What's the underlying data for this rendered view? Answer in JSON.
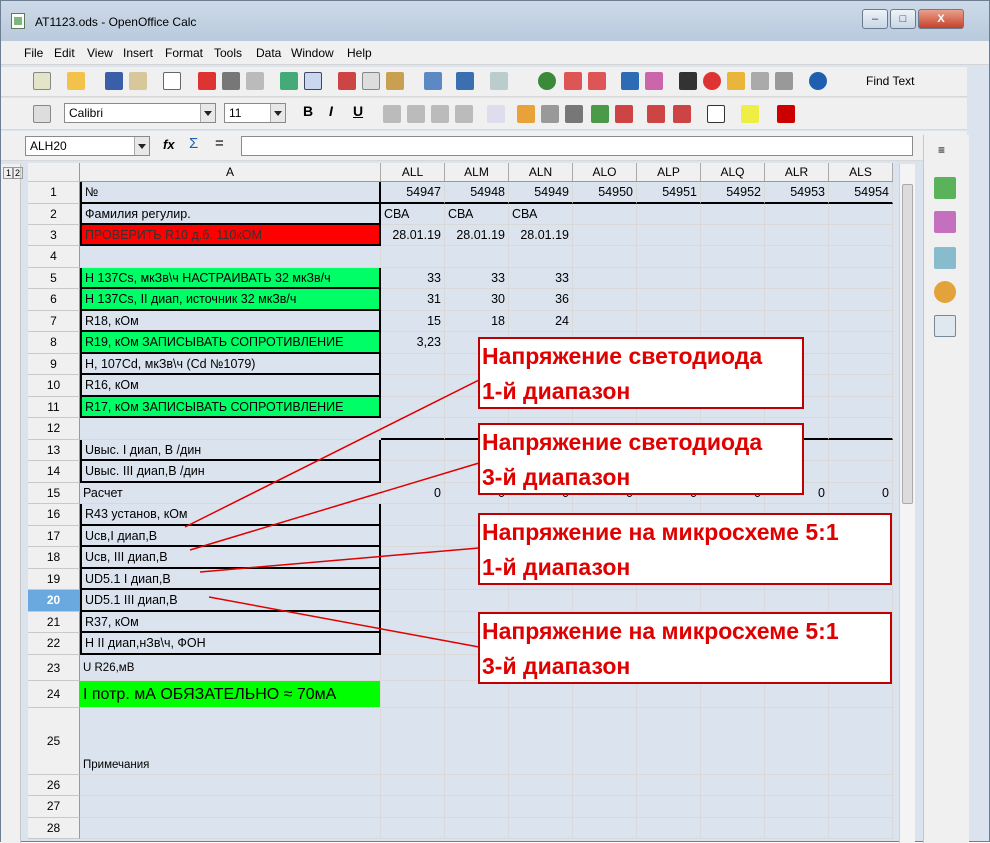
{
  "window": {
    "title": "AT1123.ods - OpenOffice Calc",
    "min": "–",
    "max": "□",
    "close": "X"
  },
  "menu": [
    "File",
    "Edit",
    "View",
    "Insert",
    "Format",
    "Tools",
    "Data",
    "Window",
    "Help"
  ],
  "toolbar": {
    "find_text": "Find Text"
  },
  "format": {
    "font": "Calibri",
    "size": "11",
    "bold": "B",
    "italic": "I",
    "underline": "U"
  },
  "formula": {
    "name_box": "ALH20",
    "fx": "fx",
    "sum": "Σ",
    "eq": "="
  },
  "outline_levels": [
    "1",
    "2"
  ],
  "columns": [
    "A",
    "ALL",
    "ALM",
    "ALN",
    "ALO",
    "ALP",
    "ALQ",
    "ALR",
    "ALS"
  ],
  "rows": [
    {
      "n": "1",
      "a": "№",
      "v": [
        "54947",
        "54948",
        "54949",
        "54950",
        "54951",
        "54952",
        "54953",
        "54954"
      ]
    },
    {
      "n": "2",
      "a": "Фамилия регулир.",
      "v": [
        "СВА",
        "СВА",
        "СВА",
        "",
        "",
        "",
        "",
        ""
      ]
    },
    {
      "n": "3",
      "a": "ПРОВЕРИТЬ R10 д.б. 110кОМ",
      "v": [
        "28.01.19",
        "28.01.19",
        "28.01.19",
        "",
        "",
        "",
        "",
        ""
      ]
    },
    {
      "n": "4",
      "a": "",
      "v": [
        "",
        "",
        "",
        "",
        "",
        "",
        "",
        ""
      ]
    },
    {
      "n": "5",
      "a": "Н 137Cs, мкЗв\\ч   НАСТРАИВАТЬ 32 мкЗв/ч",
      "v": [
        "33",
        "33",
        "33",
        "",
        "",
        "",
        "",
        ""
      ]
    },
    {
      "n": "6",
      "a": "Н 137Cs, II диап, источник 32 мкЗв/ч",
      "v": [
        "31",
        "30",
        "36",
        "",
        "",
        "",
        "",
        ""
      ]
    },
    {
      "n": "7",
      "a": "R18, кОм",
      "v": [
        "15",
        "18",
        "24",
        "",
        "",
        "",
        "",
        ""
      ]
    },
    {
      "n": "8",
      "a": "R19, кОм  ЗАПИСЫВАТЬ СОПРОТИВЛЕНИЕ",
      "v": [
        "3,23",
        "",
        "",
        "",
        "",
        "",
        "",
        ""
      ]
    },
    {
      "n": "9",
      "a": "Н, 107Cd, мкЗв\\ч   (Cd  №1079)",
      "v": [
        "",
        "",
        "",
        "",
        "",
        "",
        "",
        ""
      ]
    },
    {
      "n": "10",
      "a": "R16, кОм",
      "v": [
        "",
        "",
        "",
        "",
        "",
        "",
        "",
        ""
      ]
    },
    {
      "n": "11",
      "a": "R17, кОм ЗАПИСЫВАТЬ СОПРОТИВЛЕНИЕ",
      "v": [
        "",
        "",
        "",
        "",
        "",
        "",
        "",
        ""
      ]
    },
    {
      "n": "12",
      "a": "",
      "v": [
        "",
        "",
        "",
        "",
        "",
        "",
        "",
        ""
      ]
    },
    {
      "n": "13",
      "a": "Uвыс. I диап, В /дин",
      "v": [
        "",
        "",
        "",
        "",
        "",
        "",
        "",
        ""
      ]
    },
    {
      "n": "14",
      "a": "Uвыс. III диап,В /дин",
      "v": [
        "",
        "",
        "",
        "",
        "",
        "",
        "",
        ""
      ]
    },
    {
      "n": "15",
      "a": "Расчет",
      "v": [
        "0",
        "0",
        "0",
        "0",
        "0",
        "0",
        "0",
        "0"
      ]
    },
    {
      "n": "16",
      "a": "R43 установ, кОм",
      "v": [
        "",
        "",
        "",
        "",
        "",
        "",
        "",
        ""
      ]
    },
    {
      "n": "17",
      "a": "Uсв,I диап,В",
      "v": [
        "",
        "",
        "",
        "",
        "",
        "",
        "",
        ""
      ]
    },
    {
      "n": "18",
      "a": "Uсв, III диап,В",
      "v": [
        "",
        "",
        "",
        "",
        "",
        "",
        "",
        ""
      ]
    },
    {
      "n": "19",
      "a": "UD5.1 I диап,В",
      "v": [
        "",
        "",
        "",
        "",
        "",
        "",
        "",
        ""
      ]
    },
    {
      "n": "20",
      "a": "UD5.1 III диап,В",
      "v": [
        "",
        "",
        "",
        "",
        "",
        "",
        "",
        ""
      ]
    },
    {
      "n": "21",
      "a": "R37, кОм",
      "v": [
        "",
        "",
        "",
        "",
        "",
        "",
        "",
        ""
      ]
    },
    {
      "n": "22",
      "a": "Н II диап,нЗв\\ч, ФОН",
      "v": [
        "",
        "",
        "",
        "",
        "",
        "",
        "",
        ""
      ]
    },
    {
      "n": "23",
      "a": "U R26,мВ",
      "v": [
        "",
        "",
        "",
        "",
        "",
        "",
        "",
        ""
      ]
    },
    {
      "n": "24",
      "a": "I потр. мА ОБЯЗАТЕЛЬНО ≈ 70мА",
      "v": [
        "",
        "",
        "",
        "",
        "",
        "",
        "",
        ""
      ]
    },
    {
      "n": "25",
      "a": "Примечания",
      "v": [
        "",
        "",
        "",
        "",
        "",
        "",
        "",
        ""
      ]
    },
    {
      "n": "26",
      "a": "",
      "v": [
        "",
        "",
        "",
        "",
        "",
        "",
        "",
        ""
      ]
    },
    {
      "n": "27",
      "a": "",
      "v": [
        "",
        "",
        "",
        "",
        "",
        "",
        "",
        ""
      ]
    },
    {
      "n": "28",
      "a": "",
      "v": [
        "",
        "",
        "",
        "",
        "",
        "",
        "",
        ""
      ]
    }
  ],
  "callouts": [
    {
      "l1": "Напряжение светодиода",
      "l2": "1-й диапазон"
    },
    {
      "l1": "Напряжение светодиода",
      "l2": "3-й диапазон"
    },
    {
      "l1": "Напряжение на микросхеме 5:1",
      "l2": "1-й диапазон"
    },
    {
      "l1": "Напряжение на микросхеме 5:1",
      "l2": "3-й диапазон"
    }
  ],
  "colors": {
    "red": "#ff0000",
    "green": "#00ff66",
    "lime": "#00ff00",
    "callout": "#e00000"
  }
}
